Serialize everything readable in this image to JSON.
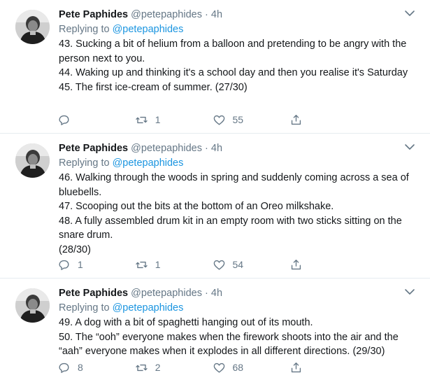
{
  "tweets": [
    {
      "name": "Pete Paphides",
      "handle": "@petepaphides",
      "dot": "·",
      "time": "4h",
      "replying_prefix": "Replying to ",
      "replying_to": "@petepaphides",
      "lines": [
        "43. Sucking a bit of helium from a balloon and pretending to be angry with the person next to you.",
        "44. Waking up and thinking it's a school day and then you realise it's Saturday",
        "45. The first ice-cream of summer. (27/30)"
      ],
      "reply_count": "",
      "retweet_count": "1",
      "like_count": "55"
    },
    {
      "name": "Pete Paphides",
      "handle": "@petepaphides",
      "dot": "·",
      "time": "4h",
      "replying_prefix": "Replying to ",
      "replying_to": "@petepaphides",
      "lines": [
        "46. Walking through the woods in spring and suddenly coming across a sea of bluebells.",
        "47. Scooping out the bits at the bottom of an Oreo milkshake.",
        "48. A fully assembled drum kit in an empty room with two sticks sitting on the snare drum.",
        "(28/30)"
      ],
      "reply_count": "1",
      "retweet_count": "1",
      "like_count": "54"
    },
    {
      "name": "Pete Paphides",
      "handle": "@petepaphides",
      "dot": "·",
      "time": "4h",
      "replying_prefix": "Replying to ",
      "replying_to": "@petepaphides",
      "lines": [
        "49. A dog with a bit of spaghetti hanging out of its mouth.",
        "50. The “ooh” everyone makes when the firework shoots into the air and the “aah” everyone makes when it explodes in all different directions. (29/30)"
      ],
      "reply_count": "8",
      "retweet_count": "2",
      "like_count": "68"
    }
  ],
  "icons": {
    "reply": "reply-icon",
    "retweet": "retweet-icon",
    "like": "heart-icon",
    "share": "share-icon",
    "caret": "chevron-down-icon"
  },
  "colors": {
    "link": "#1b95e0",
    "muted": "#657786",
    "text": "#14171a",
    "divider": "#e6ecf0"
  }
}
